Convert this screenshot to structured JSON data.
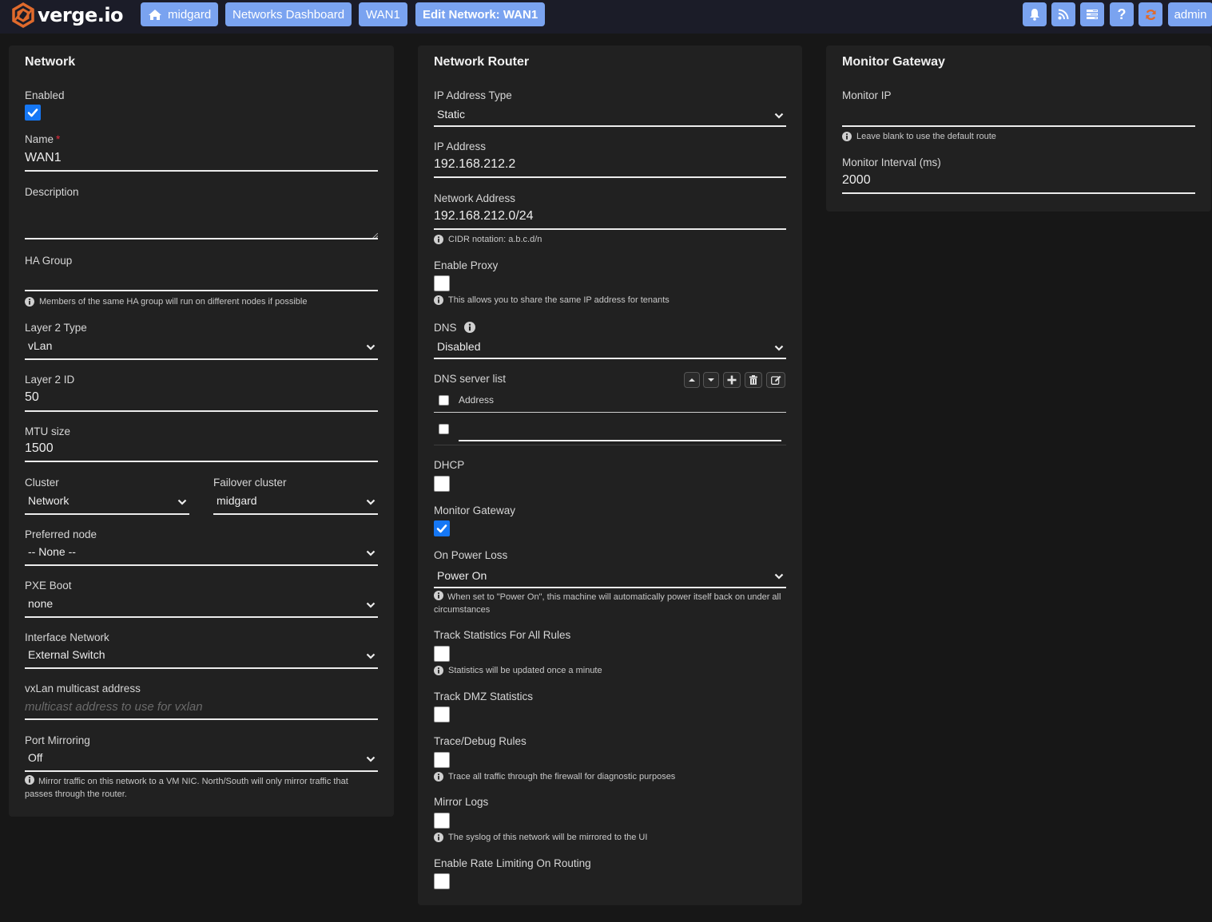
{
  "app": {
    "logo_text": "verge.io",
    "brand_color": "#e06a2c",
    "accent_color": "#7aa3f0",
    "checkbox_color": "#1577f5"
  },
  "breadcrumbs": [
    {
      "label": "midgard",
      "icon": "home-icon"
    },
    {
      "label": "Networks Dashboard"
    },
    {
      "label": "WAN1"
    },
    {
      "label": "Edit Network: WAN1"
    }
  ],
  "toolbar": {
    "icons": [
      "bell-icon",
      "rss-icon",
      "tasks-icon",
      "question-icon",
      "refresh-icon"
    ],
    "user_label": "admin"
  },
  "network_panel": {
    "title": "Network",
    "enabled": {
      "label": "Enabled",
      "checked": true
    },
    "name": {
      "label": "Name",
      "required": "*",
      "value": "WAN1"
    },
    "description": {
      "label": "Description",
      "value": ""
    },
    "ha_group": {
      "label": "HA Group",
      "value": "",
      "help": "Members of the same HA group will run on different nodes if possible"
    },
    "layer2_type": {
      "label": "Layer 2 Type",
      "value": "vLan"
    },
    "layer2_id": {
      "label": "Layer 2 ID",
      "value": "50"
    },
    "mtu": {
      "label": "MTU size",
      "value": "1500"
    },
    "cluster": {
      "label": "Cluster",
      "value": "Network"
    },
    "failover_cluster": {
      "label": "Failover cluster",
      "value": "midgard"
    },
    "preferred_node": {
      "label": "Preferred node",
      "value": "-- None --"
    },
    "pxe_boot": {
      "label": "PXE Boot",
      "value": "none"
    },
    "interface_network": {
      "label": "Interface Network",
      "value": "External Switch"
    },
    "vxlan": {
      "label": "vxLan multicast address",
      "value": "",
      "placeholder": "multicast address to use for vxlan"
    },
    "port_mirroring": {
      "label": "Port Mirroring",
      "value": "Off",
      "help": "Mirror traffic on this network to a VM NIC. North/South will only mirror traffic that passes through the router."
    }
  },
  "router_panel": {
    "title": "Network Router",
    "ip_type": {
      "label": "IP Address Type",
      "value": "Static"
    },
    "ip_address": {
      "label": "IP Address",
      "value": "192.168.212.2"
    },
    "network_address": {
      "label": "Network Address",
      "value": "192.168.212.0/24",
      "help": "CIDR notation: a.b.c.d/n"
    },
    "enable_proxy": {
      "label": "Enable Proxy",
      "checked": false,
      "help": "This allows you to share the same IP address for tenants"
    },
    "dns": {
      "label": "DNS",
      "value": "Disabled"
    },
    "dns_list": {
      "label": "DNS server list",
      "column_header": "Address",
      "buttons": [
        "move-up-icon",
        "move-down-icon",
        "add-icon",
        "delete-icon",
        "edit-icon"
      ],
      "rows": [
        {
          "address": ""
        }
      ]
    },
    "dhcp": {
      "label": "DHCP",
      "checked": false
    },
    "monitor_gateway": {
      "label": "Monitor Gateway",
      "checked": true
    },
    "power_loss": {
      "label": "On Power Loss",
      "value": "Power On",
      "help": "When set to \"Power On\", this machine will automatically power itself back on under all circumstances"
    },
    "track_stats": {
      "label": "Track Statistics For All Rules",
      "checked": false,
      "help": "Statistics will be updated once a minute"
    },
    "track_dmz": {
      "label": "Track DMZ Statistics",
      "checked": false
    },
    "trace_debug": {
      "label": "Trace/Debug Rules",
      "checked": false,
      "help": "Trace all traffic through the firewall for diagnostic purposes"
    },
    "mirror_logs": {
      "label": "Mirror Logs",
      "checked": false,
      "help": "The syslog of this network will be mirrored to the UI"
    },
    "rate_limiting": {
      "label": "Enable Rate Limiting On Routing",
      "checked": false
    }
  },
  "gateway_panel": {
    "title": "Monitor Gateway",
    "monitor_ip": {
      "label": "Monitor IP",
      "value": "",
      "help": "Leave blank to use the default route"
    },
    "monitor_interval": {
      "label": "Monitor Interval (ms)",
      "value": "2000"
    }
  }
}
